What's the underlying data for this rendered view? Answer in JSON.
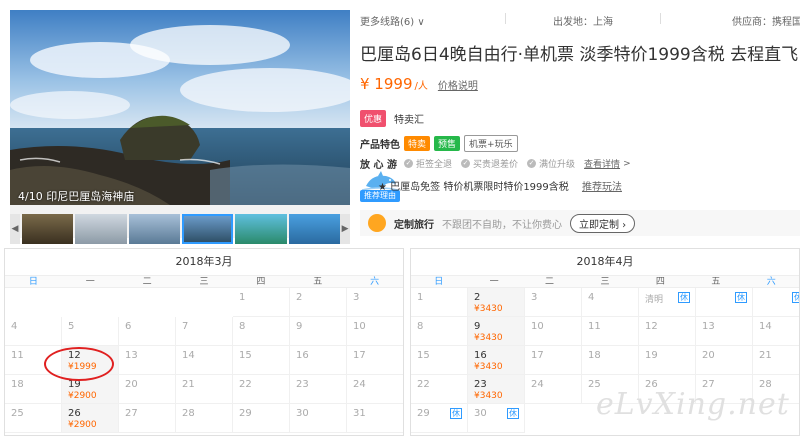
{
  "gallery": {
    "caption": "4/10 印尼巴厘岛海神庙",
    "prev_arrow": "◀",
    "next_arrow": "▶"
  },
  "topbar": {
    "more_routes": "更多线路(6) ∨",
    "departure": "出发地：上海",
    "supplier": "供应商：携程国旅"
  },
  "product": {
    "title": "巴厘岛6日4晚自由行·单机票 淡季特价1999含税 去程直飞",
    "price": "¥ 1999",
    "per": "/人",
    "price_note": "价格说明",
    "promo_badge": "优惠",
    "promo_text": "特卖汇",
    "features_label": "产品特色",
    "feature_tags": [
      "特卖",
      "预售",
      "机票+玩乐"
    ],
    "assure_label": "放 心 游",
    "assure_items": [
      "拒签全退",
      "买贵退差价",
      "满位升级"
    ],
    "detail_link": "查看详情",
    "detail_arrow": ">",
    "recommend_badge": "推荐理由",
    "recommend_text": "★ 巴厘岛免签 特价机票限时特价1999含税",
    "recommend_link": "推荐玩法",
    "custom_title": "定制旅行",
    "custom_sub": "不跟团不自助，不让你费心",
    "custom_button": "立即定制 ›"
  },
  "weekdays": [
    "日",
    "一",
    "二",
    "三",
    "四",
    "五",
    "六"
  ],
  "calendars": {
    "march": {
      "title": "2018年3月",
      "cells": [
        {
          "col": 4,
          "row": 0,
          "day": "1"
        },
        {
          "col": 5,
          "row": 0,
          "day": "2"
        },
        {
          "col": 6,
          "row": 0,
          "day": "3"
        },
        {
          "col": 0,
          "row": 1,
          "day": "4"
        },
        {
          "col": 1,
          "row": 1,
          "day": "5"
        },
        {
          "col": 2,
          "row": 1,
          "day": "6"
        },
        {
          "col": 3,
          "row": 1,
          "day": "7"
        },
        {
          "col": 4,
          "row": 1,
          "day": "8"
        },
        {
          "col": 5,
          "row": 1,
          "day": "9"
        },
        {
          "col": 6,
          "row": 1,
          "day": "10"
        },
        {
          "col": 0,
          "row": 2,
          "day": "11"
        },
        {
          "col": 1,
          "row": 2,
          "day": "12",
          "price": "¥1999"
        },
        {
          "col": 2,
          "row": 2,
          "day": "13"
        },
        {
          "col": 3,
          "row": 2,
          "day": "14"
        },
        {
          "col": 4,
          "row": 2,
          "day": "15"
        },
        {
          "col": 5,
          "row": 2,
          "day": "16"
        },
        {
          "col": 6,
          "row": 2,
          "day": "17"
        },
        {
          "col": 0,
          "row": 3,
          "day": "18"
        },
        {
          "col": 1,
          "row": 3,
          "day": "19",
          "price": "¥2900"
        },
        {
          "col": 2,
          "row": 3,
          "day": "20"
        },
        {
          "col": 3,
          "row": 3,
          "day": "21"
        },
        {
          "col": 4,
          "row": 3,
          "day": "22"
        },
        {
          "col": 5,
          "row": 3,
          "day": "23"
        },
        {
          "col": 6,
          "row": 3,
          "day": "24"
        },
        {
          "col": 0,
          "row": 4,
          "day": "25"
        },
        {
          "col": 1,
          "row": 4,
          "day": "26",
          "price": "¥2900"
        },
        {
          "col": 2,
          "row": 4,
          "day": "27"
        },
        {
          "col": 3,
          "row": 4,
          "day": "28"
        },
        {
          "col": 4,
          "row": 4,
          "day": "29"
        },
        {
          "col": 5,
          "row": 4,
          "day": "30"
        },
        {
          "col": 6,
          "row": 4,
          "day": "31"
        }
      ]
    },
    "april": {
      "title": "2018年4月",
      "cells": [
        {
          "col": 0,
          "row": 0,
          "day": "1"
        },
        {
          "col": 1,
          "row": 0,
          "day": "2",
          "price": "¥3430"
        },
        {
          "col": 2,
          "row": 0,
          "day": "3"
        },
        {
          "col": 3,
          "row": 0,
          "day": "4"
        },
        {
          "col": 4,
          "row": 0,
          "day": "清明",
          "rest": "休"
        },
        {
          "col": 5,
          "row": 0,
          "day": "",
          "rest": "休"
        },
        {
          "col": 6,
          "row": 0,
          "day": "",
          "rest": "休"
        },
        {
          "col": 0,
          "row": 1,
          "day": "8"
        },
        {
          "col": 1,
          "row": 1,
          "day": "9",
          "price": "¥3430"
        },
        {
          "col": 2,
          "row": 1,
          "day": "10"
        },
        {
          "col": 3,
          "row": 1,
          "day": "11"
        },
        {
          "col": 4,
          "row": 1,
          "day": "12"
        },
        {
          "col": 5,
          "row": 1,
          "day": "13"
        },
        {
          "col": 6,
          "row": 1,
          "day": "14"
        },
        {
          "col": 0,
          "row": 2,
          "day": "15"
        },
        {
          "col": 1,
          "row": 2,
          "day": "16",
          "price": "¥3430"
        },
        {
          "col": 2,
          "row": 2,
          "day": "17"
        },
        {
          "col": 3,
          "row": 2,
          "day": "18"
        },
        {
          "col": 4,
          "row": 2,
          "day": "19"
        },
        {
          "col": 5,
          "row": 2,
          "day": "20"
        },
        {
          "col": 6,
          "row": 2,
          "day": "21"
        },
        {
          "col": 0,
          "row": 3,
          "day": "22"
        },
        {
          "col": 1,
          "row": 3,
          "day": "23",
          "price": "¥3430"
        },
        {
          "col": 2,
          "row": 3,
          "day": "24"
        },
        {
          "col": 3,
          "row": 3,
          "day": "25"
        },
        {
          "col": 4,
          "row": 3,
          "day": "26"
        },
        {
          "col": 5,
          "row": 3,
          "day": "27"
        },
        {
          "col": 6,
          "row": 3,
          "day": "28"
        },
        {
          "col": 0,
          "row": 4,
          "day": "29",
          "rest": "休"
        },
        {
          "col": 1,
          "row": 4,
          "day": "30",
          "rest": "休"
        }
      ]
    }
  },
  "watermark": "eLvXing.net",
  "colors": {
    "accent_orange": "#ff6600",
    "accent_blue": "#2f9bff",
    "highlight_red": "#e02020"
  }
}
